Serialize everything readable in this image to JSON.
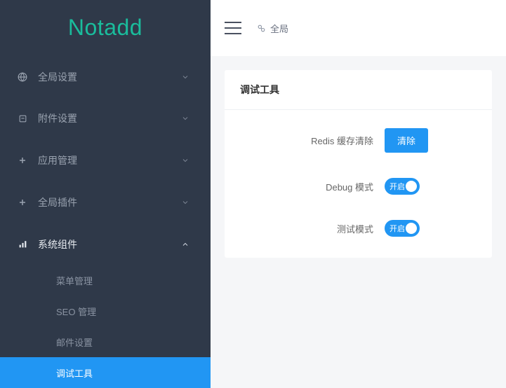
{
  "brand": {
    "name": "Notadd"
  },
  "sidebar": {
    "items": [
      {
        "label": "全局设置",
        "icon": "globe"
      },
      {
        "label": "附件设置",
        "icon": "file"
      },
      {
        "label": "应用管理",
        "icon": "plus"
      },
      {
        "label": "全局插件",
        "icon": "plus"
      },
      {
        "label": "系统组件",
        "icon": "component"
      }
    ],
    "sub": [
      {
        "label": "菜单管理"
      },
      {
        "label": "SEO 管理"
      },
      {
        "label": "邮件设置"
      },
      {
        "label": "调试工具"
      }
    ]
  },
  "breadcrumb": {
    "root": "全局"
  },
  "panel": {
    "title": "调试工具",
    "rows": {
      "redis": {
        "label": "Redis 缓存清除",
        "action": "清除"
      },
      "debug": {
        "label": "Debug 模式",
        "state": "开启"
      },
      "test": {
        "label": "测试模式",
        "state": "开启"
      }
    }
  }
}
